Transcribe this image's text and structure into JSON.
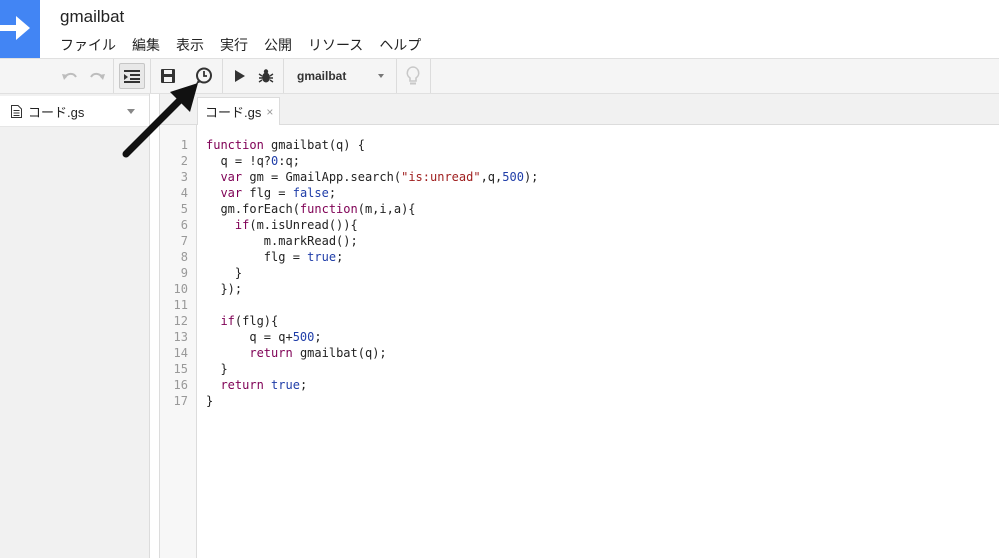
{
  "header": {
    "app_title": "gmailbat",
    "menu": [
      "ファイル",
      "編集",
      "表示",
      "実行",
      "公開",
      "リソース",
      "ヘルプ"
    ]
  },
  "toolbar": {
    "undo_icon": "undo-icon",
    "redo_icon": "redo-icon",
    "indent_icon": "indent-icon",
    "save_icon": "save-icon",
    "triggers_icon": "clock-icon",
    "run_icon": "play-icon",
    "debug_icon": "bug-icon",
    "function_select_value": "gmailbat",
    "lightbulb_icon": "lightbulb-icon"
  },
  "sidebar": {
    "files": [
      {
        "name": "コード.gs",
        "icon": "document-icon"
      }
    ]
  },
  "tabs": [
    {
      "label": "コード.gs",
      "close": "×"
    }
  ],
  "editor": {
    "line_numbers": [
      "1",
      "2",
      "3",
      "4",
      "5",
      "6",
      "7",
      "8",
      "9",
      "10",
      "11",
      "12",
      "13",
      "14",
      "15",
      "16",
      "17"
    ],
    "lines": [
      "function gmailbat(q) {",
      "  q = !q?0:q;",
      "  var gm = GmailApp.search(\"is:unread\",q,500);",
      "  var flg = false;",
      "  gm.forEach(function(m,i,a){",
      "    if(m.isUnread()){",
      "        m.markRead();",
      "        flg = true;",
      "    }",
      "  });",
      "",
      "  if(flg){",
      "      q = q+500;",
      "      return gmailbat(q);",
      "  }",
      "  return true;",
      "}"
    ]
  },
  "colors": {
    "brand_blue": "#4285f4",
    "keyword": "#7f0055",
    "identifier": "#1f3da8",
    "string": "#a02020"
  }
}
